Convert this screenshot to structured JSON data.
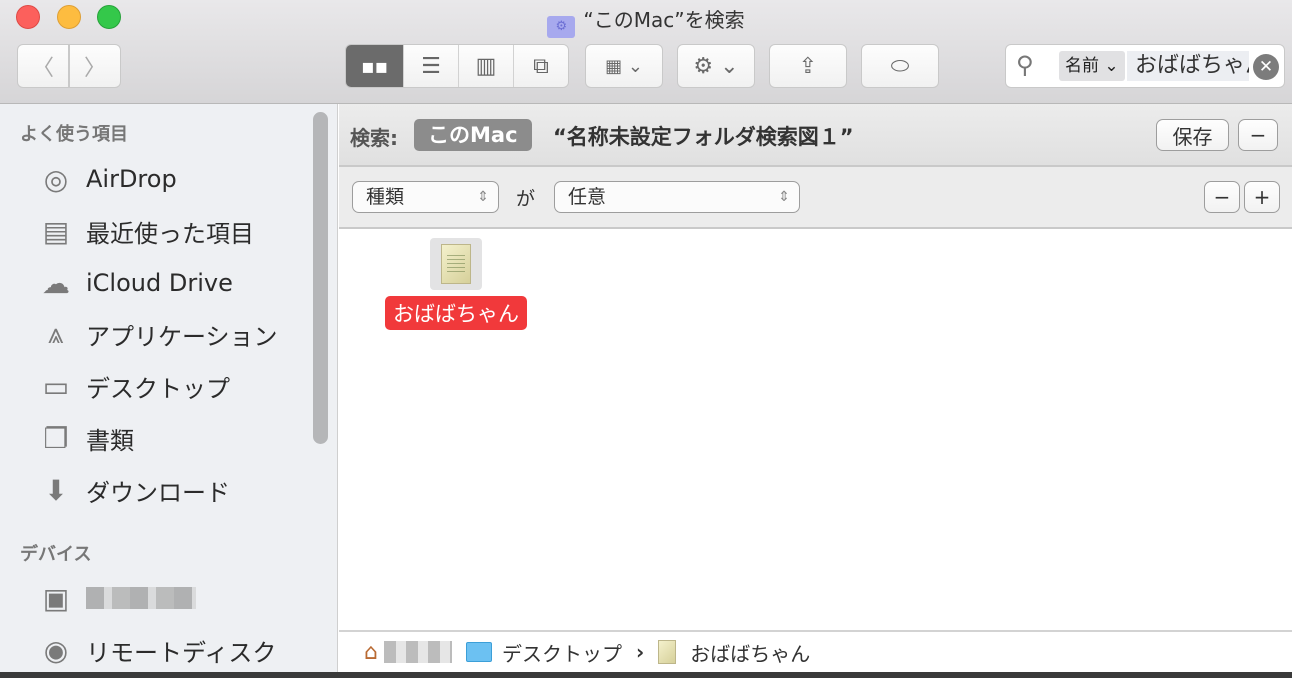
{
  "window": {
    "title": "“このMac”を検索"
  },
  "toolbar": {
    "back_icon": "chevron-left",
    "forward_icon": "chevron-right",
    "view_modes": [
      "icon",
      "list",
      "column",
      "coverflow"
    ],
    "active_view": "icon",
    "arrange_icon": "grid",
    "action_icon": "gear",
    "share_icon": "share",
    "tag_icon": "tag",
    "search": {
      "token": "名前",
      "query": "おばばちゃん"
    }
  },
  "sidebar": {
    "favorites_header": "よく使う項目",
    "favorites": [
      {
        "label": "AirDrop",
        "icon": "airdrop"
      },
      {
        "label": "最近使った項目",
        "icon": "recents"
      },
      {
        "label": "iCloud Drive",
        "icon": "cloud"
      },
      {
        "label": "アプリケーション",
        "icon": "applications"
      },
      {
        "label": "デスクトップ",
        "icon": "desktop"
      },
      {
        "label": "書類",
        "icon": "documents"
      },
      {
        "label": "ダウンロード",
        "icon": "download"
      }
    ],
    "devices_header": "デバイス",
    "devices": [
      {
        "label": "",
        "icon": "hard-drive"
      },
      {
        "label": "リモートディスク",
        "icon": "disc"
      }
    ]
  },
  "scope_bar": {
    "label": "検索:",
    "scope": "このMac",
    "search_name": "“名称未設定フォルダ検索図１”",
    "save_label": "保存",
    "remove_label": "−"
  },
  "criteria": {
    "attribute": "種類",
    "connector": "が",
    "value": "任意",
    "remove_label": "−",
    "add_label": "+"
  },
  "results": [
    {
      "name": "おばばちゃん",
      "tag_color": "#f1393b"
    }
  ],
  "path_bar": {
    "items": [
      "デスクトップ",
      "おばばちゃん"
    ],
    "separator": "›"
  }
}
